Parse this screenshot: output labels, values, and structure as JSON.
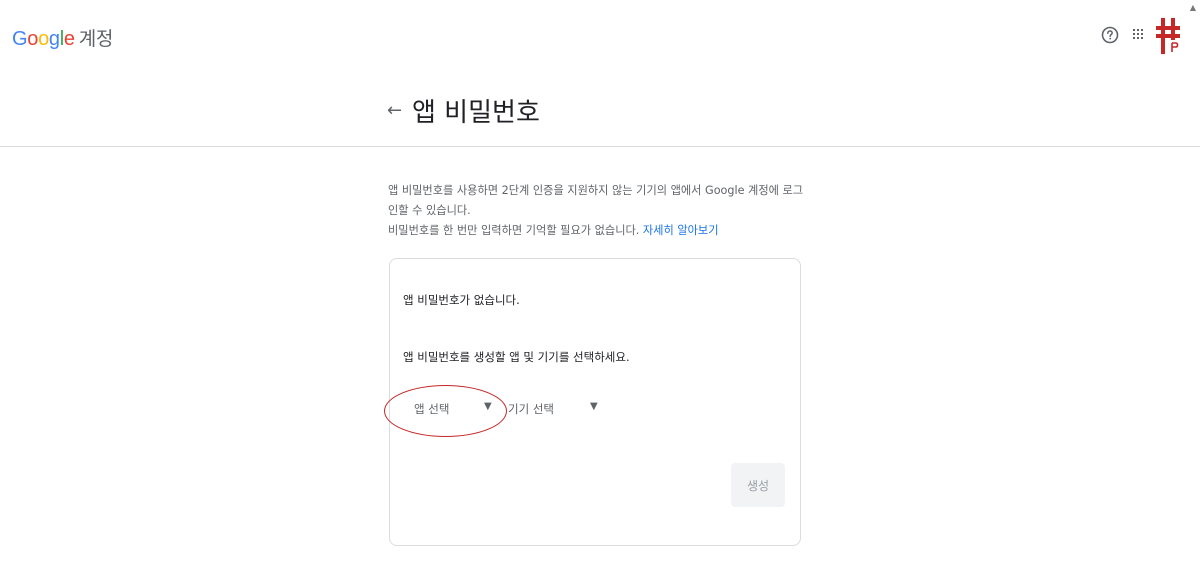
{
  "header": {
    "logo_letters": [
      "G",
      "o",
      "o",
      "g",
      "l",
      "e"
    ],
    "account_label": "계정",
    "help_icon": "help-circle-icon",
    "apps_icon": "apps-grid-icon",
    "avatar_icon": "profile-avatar"
  },
  "page": {
    "back_icon": "arrow-back-icon",
    "title": "앱 비밀번호",
    "description_line1": "앱 비밀번호를 사용하면 2단계 인증을 지원하지 않는 기기의 앱에서 Google 계정에 로그인할 수 있습니다.",
    "description_line2": "비밀번호를 한 번만 입력하면 기억할 필요가 없습니다. ",
    "learn_more": "자세히 알아보기"
  },
  "card": {
    "no_passwords": "앱 비밀번호가 없습니다.",
    "instruction": "앱 비밀번호를 생성할 앱 및 기기를 선택하세요.",
    "app_select": {
      "value": "앱 선택",
      "caret": "▼"
    },
    "device_select": {
      "value": "기기 선택",
      "caret": "▼"
    },
    "generate_label": "생성"
  },
  "colors": {
    "accent_link": "#1a73e8",
    "highlight": "#c62828",
    "divider": "#dadce0"
  }
}
